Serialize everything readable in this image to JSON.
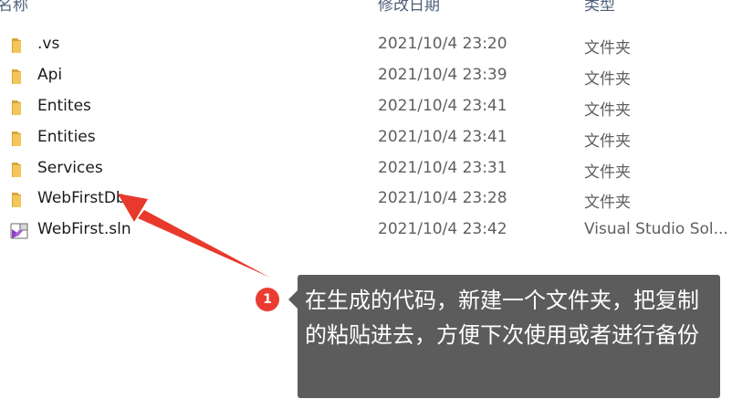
{
  "header": {
    "name": "名称",
    "date": "修改日期",
    "type": "类型"
  },
  "files": [
    {
      "name": ".vs",
      "date": "2021/10/4 23:20",
      "type": "文件夹",
      "icon": "folder-icon"
    },
    {
      "name": "Api",
      "date": "2021/10/4 23:39",
      "type": "文件夹",
      "icon": "folder-icon"
    },
    {
      "name": "Entites",
      "date": "2021/10/4 23:41",
      "type": "文件夹",
      "icon": "folder-icon"
    },
    {
      "name": "Entities",
      "date": "2021/10/4 23:41",
      "type": "文件夹",
      "icon": "folder-icon"
    },
    {
      "name": "Services",
      "date": "2021/10/4 23:31",
      "type": "文件夹",
      "icon": "folder-icon"
    },
    {
      "name": "WebFirstDb",
      "date": "2021/10/4 23:28",
      "type": "文件夹",
      "icon": "folder-icon"
    },
    {
      "name": "WebFirst.sln",
      "date": "2021/10/4 23:42",
      "type": "Visual Studio Sol...",
      "icon": "visual-studio-solution-icon"
    }
  ],
  "annotation": {
    "number": "1",
    "text": "在生成的代码，新建一个文件夹，把复制的粘贴进去，方便下次使用或者进行备份"
  },
  "colors": {
    "folder": "#e8b84a",
    "arrow": "#e8392c",
    "badge": "#ea3c30",
    "tooltip_bg": "#5c5c5c"
  }
}
